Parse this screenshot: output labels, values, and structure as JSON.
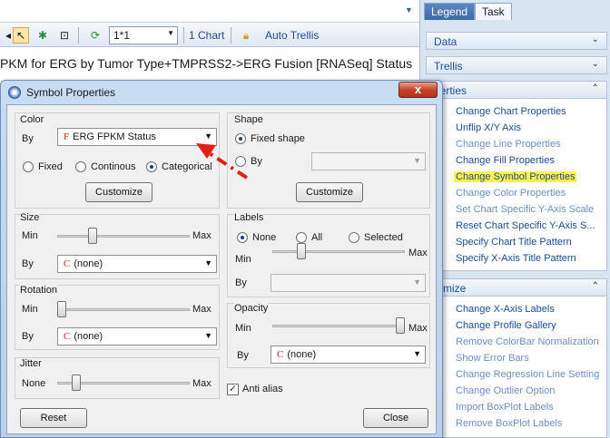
{
  "app": {
    "toolbar": {
      "combo_value": "1*1",
      "chart_link": "1 Chart",
      "auto_trellis_link": "Auto Trellis"
    },
    "chart_title": "PKM for ERG by Tumor Type+TMPRSS2->ERG Fusion [RNASeq] Status"
  },
  "right_panel": {
    "tabs": [
      "Legend",
      "Task"
    ],
    "sections": [
      {
        "label": "Data"
      },
      {
        "label": "Trellis"
      },
      {
        "label": "perties"
      },
      {
        "label": "tomize"
      }
    ],
    "properties_items": [
      {
        "label": "Change Chart Properties",
        "muted": false
      },
      {
        "label": "Unflip X/Y Axis",
        "muted": false
      },
      {
        "label": "Change Line Properties",
        "muted": true
      },
      {
        "label": "Change Fill Properties",
        "muted": false
      },
      {
        "label": "Change Symbol Properties",
        "muted": false,
        "highlight": true
      },
      {
        "label": "Change Color Properties",
        "muted": true
      },
      {
        "label": "Set Chart Specific Y-Axis Scale",
        "muted": true
      },
      {
        "label": "Reset Chart Specific Y-Axis S...",
        "muted": false
      },
      {
        "label": "Specify Chart Title Pattern",
        "muted": false
      },
      {
        "label": "Specify X-Axis Title Pattern",
        "muted": false
      }
    ],
    "customize_items": [
      {
        "label": "Change X-Axis Labels",
        "muted": false
      },
      {
        "label": "Change Profile Gallery",
        "muted": false
      },
      {
        "label": "Remove ColorBar Normalization",
        "muted": true
      },
      {
        "label": "Show Error Bars",
        "muted": true
      },
      {
        "label": "Change Regression Line Setting",
        "muted": true
      },
      {
        "label": "Change Outlier Option",
        "muted": true
      },
      {
        "label": "Import BoxPlot Labels",
        "muted": true
      },
      {
        "label": "Remove BoxPlot Labels",
        "muted": true
      }
    ]
  },
  "dialog": {
    "title": "Symbol Properties",
    "close_glyph": "x",
    "color": {
      "group_label": "Color",
      "by_label": "By",
      "by_icon": "F",
      "by_value": "ERG FPKM Status",
      "radios": [
        {
          "label": "Fixed",
          "checked": false
        },
        {
          "label": "Continous",
          "checked": false
        },
        {
          "label": "Categorical",
          "checked": true
        }
      ],
      "customize_label": "Customize"
    },
    "shape": {
      "group_label": "Shape",
      "fixed_label": "Fixed shape",
      "by_label": "By",
      "customize_label": "Customize"
    },
    "size": {
      "group_label": "Size",
      "min_label": "Min",
      "max_label": "Max",
      "by_label": "By",
      "by_icon": "C",
      "by_value": "(none)",
      "slider_level": 0.25
    },
    "labels": {
      "group_label": "Labels",
      "radios": [
        {
          "label": "None",
          "checked": true
        },
        {
          "label": "All",
          "checked": false
        },
        {
          "label": "Selected",
          "checked": false
        }
      ],
      "min_label": "Min",
      "max_label": "Max",
      "by_label": "By",
      "slider_level": 0.2
    },
    "rotation": {
      "group_label": "Rotation",
      "min_label": "Min",
      "max_label": "Max",
      "by_label": "By",
      "by_icon": "C",
      "by_value": "(none)",
      "slider_level": 0.0
    },
    "opacity": {
      "group_label": "Opacity",
      "min_label": "Min",
      "max_label": "Max",
      "by_label": "By",
      "by_icon": "C",
      "by_value": "(none)",
      "slider_level": 1.0
    },
    "jitter": {
      "group_label": "Jitter",
      "min_label": "None",
      "max_label": "Max",
      "slider_level": 0.12
    },
    "anti_alias_label": "Anti alias",
    "anti_alias_checked": true,
    "reset_label": "Reset",
    "close_label": "Close"
  },
  "colors": {
    "highlight": "#fff24a",
    "link": "#1c4b9c",
    "annotation_arrow": "#e0201b"
  }
}
